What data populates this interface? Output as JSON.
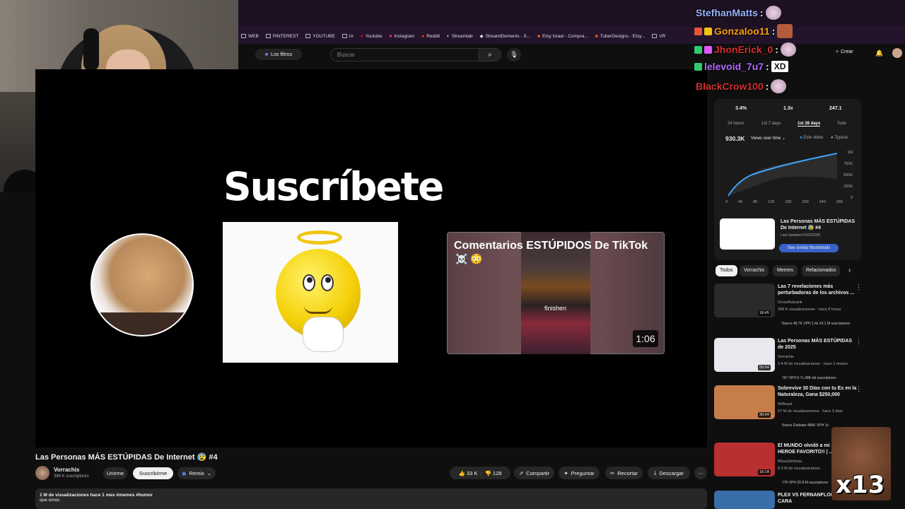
{
  "browser": {
    "bookmarks": [
      "WEB",
      "PINTEREST",
      "YOUTUBE",
      "IA",
      "Youtube",
      "Instagram",
      "Reddit",
      "Streamlab",
      "StreamElements - S...",
      "Etsy Israel - Compra...",
      "TuberDesigns - Etsy...",
      "VR"
    ]
  },
  "youtube": {
    "filters_label": "Los filtros",
    "search_placeholder": "Buscar",
    "create_label": "Crear"
  },
  "player": {
    "overlay_text": "Suscríbete",
    "embed": {
      "title": "Comentarios ESTÚPIDOS De TikTok",
      "emoji": "☠️ 😳",
      "caption": "finishen",
      "duration": "1:06"
    }
  },
  "video": {
    "title": "Las Personas MÁS ESTÚPIDAS De Internet 😰 #4",
    "channel": "Vorrachis",
    "subscribers": "388 K suscriptores",
    "join_label": "Unirme",
    "subscribe_label": "Suscribirme",
    "remix_label": "Remix",
    "likes": "33 K",
    "dislikes": "128",
    "share_label": "Compartir",
    "ask_label": "Preguntar",
    "clip_label": "Recortar",
    "download_label": "Descargar",
    "desc_meta": "1 M de visualizaciones  hace 1 mes  #memes #humor",
    "desc_text": "que emoc"
  },
  "chat": [
    {
      "user": "StefhanMatts",
      "color": "#9bb4ff",
      "suffix": ":",
      "emote": true
    },
    {
      "user": "Gonzaloo11",
      "color": "#ff9f1c",
      "suffix": ":",
      "emote": true
    },
    {
      "user": "JhonErick_0",
      "color": "#d63031",
      "suffix": ":",
      "emote": true
    },
    {
      "user": "lelevoid_7u7",
      "color": "#b26bff",
      "suffix": ":",
      "text": "XD"
    },
    {
      "user": "BlackCrow100",
      "color": "#d63031",
      "suffix": ":",
      "emote": true
    }
  ],
  "stats": {
    "values": [
      "3.4%",
      "1.3x",
      "247.1"
    ],
    "ranges": [
      "24 hours",
      "1st 7 days",
      "1st 28 days",
      "Todo"
    ],
    "views": "930.3K",
    "views_select": "Views over time",
    "legend_a": "Este video",
    "legend_b": "Typical",
    "y_ticks": [
      "1M",
      "750K",
      "500K",
      "250K",
      "0"
    ],
    "x_ticks": [
      "0",
      "40",
      "80",
      "120",
      "160",
      "200",
      "240",
      "280"
    ],
    "similar_title": "Las Personas MÁS ESTÚPIDAS De Internet 😰 #4",
    "similar_date": "Last Updated 01/01/2026",
    "similar_button": "See similar thumbnails"
  },
  "chips": [
    "Todos",
    "Vorrachis",
    "Memes",
    "Relacionados"
  ],
  "recommendations": [
    {
      "title": "Las 7 revelaciones más perturbadoras de los archivos ...",
      "channel": "DrossRotzank",
      "meta": "398 K visualizaciones · hace 8 horas",
      "badges": "Nuevo   48.7K VPH  1.4x   24.1 M suscriptores",
      "duration": "18:45",
      "color": "#2a2a2a"
    },
    {
      "title": "Las Personas MÁS ESTÚPIDAS de 2025",
      "channel": "Vorrachis",
      "meta": "3.4 M de visualizaciones · hace 2 meses",
      "badges": "767 VPH  5.7x   388 mil suscriptores",
      "duration": "55:54",
      "color": "#e8e8ee"
    },
    {
      "title": "Sobrevive 30 Días con tu Ex en la Naturaleza, Gana $250,000",
      "channel": "MrBeast",
      "meta": "57 M de visualizaciones · hace 3 días",
      "badges": "Nuevo  Doblado   486K VPH  1x",
      "duration": "30:04",
      "color": "#c77d4a"
    },
    {
      "title": "El MUNDO olvidó a mi S... HEROE FAVORITO!! | ...",
      "channel": "MissaSinfonia",
      "meta": "8.3 M de visualizaciones",
      "badges": "770 VPH   20.8 M suscriptores",
      "duration": "16:14",
      "color": "#b8302f"
    },
    {
      "title": "PLEX VS FERNANFLOO | C... A CARA",
      "channel": "",
      "meta": "",
      "badges": "",
      "duration": "",
      "color": "#3a6ea8"
    }
  ],
  "meme_text": "x13"
}
